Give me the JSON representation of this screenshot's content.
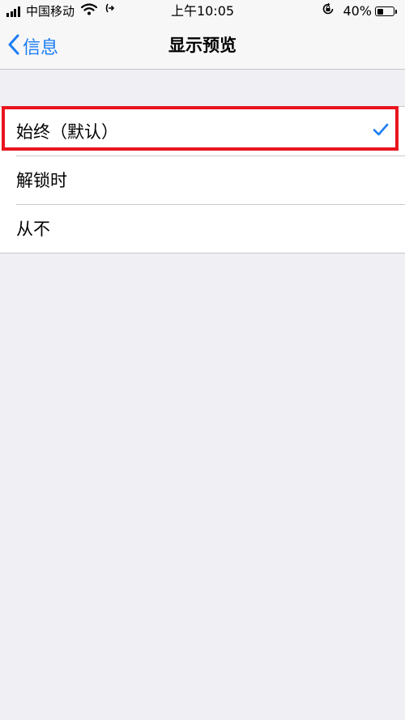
{
  "status_bar": {
    "carrier": "中国移动",
    "time": "上午10:05",
    "battery_percent": "40%",
    "battery_level": 0.4,
    "icons": [
      "signal-icon",
      "wifi-icon",
      "link-icon",
      "rotation-lock-icon",
      "battery-icon"
    ]
  },
  "nav": {
    "back_label": "信息",
    "title": "显示预览"
  },
  "options": [
    {
      "label": "始终（默认）",
      "selected": true
    },
    {
      "label": "解锁时",
      "selected": false
    },
    {
      "label": "从不",
      "selected": false
    }
  ],
  "colors": {
    "accent": "#1a7cf5",
    "highlight": "#e8151e",
    "background": "#efeff4"
  }
}
